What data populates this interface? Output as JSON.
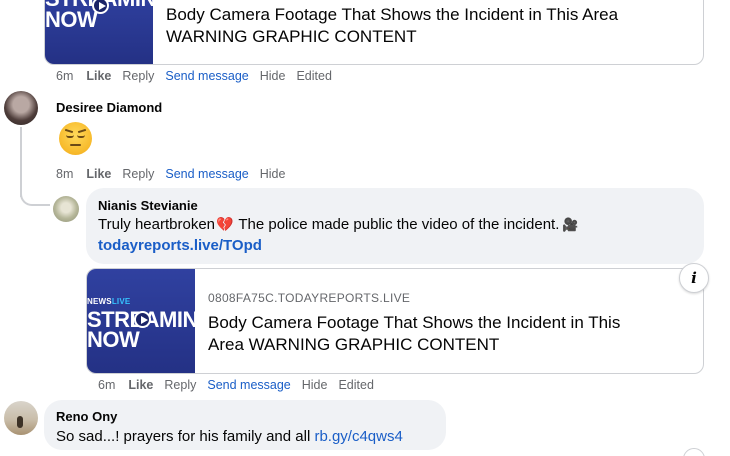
{
  "comments": {
    "top_card": {
      "thumb_big_line1": "STREAMIN",
      "thumb_big_line2": "NOW",
      "title_line1": "Body Camera Footage That Shows the Incident in This Area",
      "title_line2": "WARNING GRAPHIC CONTENT"
    },
    "top_actions": {
      "time": "6m",
      "like": "Like",
      "reply": "Reply",
      "send": "Send message",
      "hide": "Hide",
      "edited": "Edited"
    },
    "desiree": {
      "name": "Desiree Diamond",
      "emoji": "pensive-face",
      "actions": {
        "time": "8m",
        "like": "Like",
        "reply": "Reply",
        "send": "Send message",
        "hide": "Hide"
      }
    },
    "nianis": {
      "name": "Nianis Stevianie",
      "text_before": "Truly heartbroken",
      "text_after": " The police made public the video of the incident.",
      "link": "todayreports.live/TOpd",
      "card": {
        "thumb_small_prefix": "NEWS",
        "thumb_small_accent": "LIVE",
        "thumb_big_line1": "STREAMIN",
        "thumb_big_line2": "NOW",
        "domain": "0808FA75C.TODAYREPORTS.LIVE",
        "title_line1": "Body Camera Footage That Shows the Incident in This",
        "title_line2": "Area WARNING GRAPHIC CONTENT"
      },
      "actions": {
        "time": "6m",
        "like": "Like",
        "reply": "Reply",
        "send": "Send message",
        "hide": "Hide",
        "edited": "Edited"
      }
    },
    "reno": {
      "name": "Reno Ony",
      "text": "So sad...! prayers for his family and all",
      "link": "rb.gy/c4qws4"
    }
  },
  "colors": {
    "link": "#1a5ec7",
    "bubble": "#f0f2f5",
    "meta": "#65676b",
    "thumb": "#2b3a8c"
  }
}
